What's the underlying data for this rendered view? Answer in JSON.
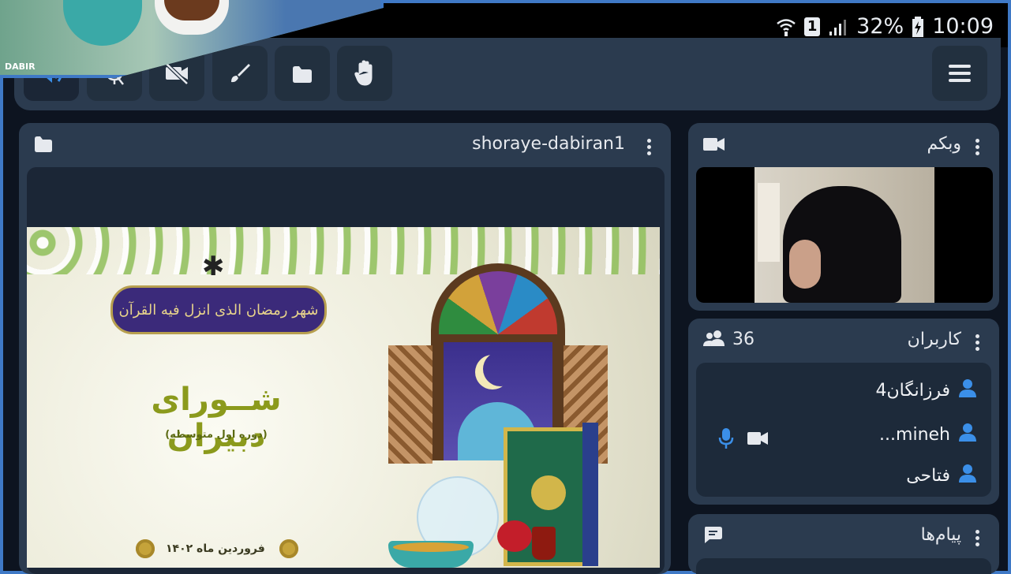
{
  "status_bar": {
    "battery_percent": "32%",
    "time": "10:09",
    "sim": "1"
  },
  "toolbar": {
    "buttons": [
      "speaker",
      "mic-off",
      "camera-off",
      "brush",
      "folder",
      "hand"
    ],
    "menu": "menu"
  },
  "presentation": {
    "title": "shoraye-dabiran1",
    "slide": {
      "headline": "شــورای دبیران",
      "subtitle": "(دوره اول متوسطه)",
      "date": "فروردین ماه ۱۴۰۲",
      "calligraphy": "شهر رمضان الذی انزل فیه القرآن"
    }
  },
  "webcam": {
    "title": "وبکم"
  },
  "users": {
    "title": "کاربران",
    "count": "36",
    "list": [
      {
        "name": "فرزانگان4"
      },
      {
        "name": "...mineh"
      },
      {
        "name": "فتاحی"
      }
    ]
  },
  "messages": {
    "title": "پیام‌ها"
  },
  "thumbnail": {
    "watermark": "DABIR"
  },
  "colors": {
    "accent": "#3b8fe8",
    "panel": "#2b3b4f",
    "inner": "#1d2a3a",
    "frame": "#3f79c6"
  }
}
